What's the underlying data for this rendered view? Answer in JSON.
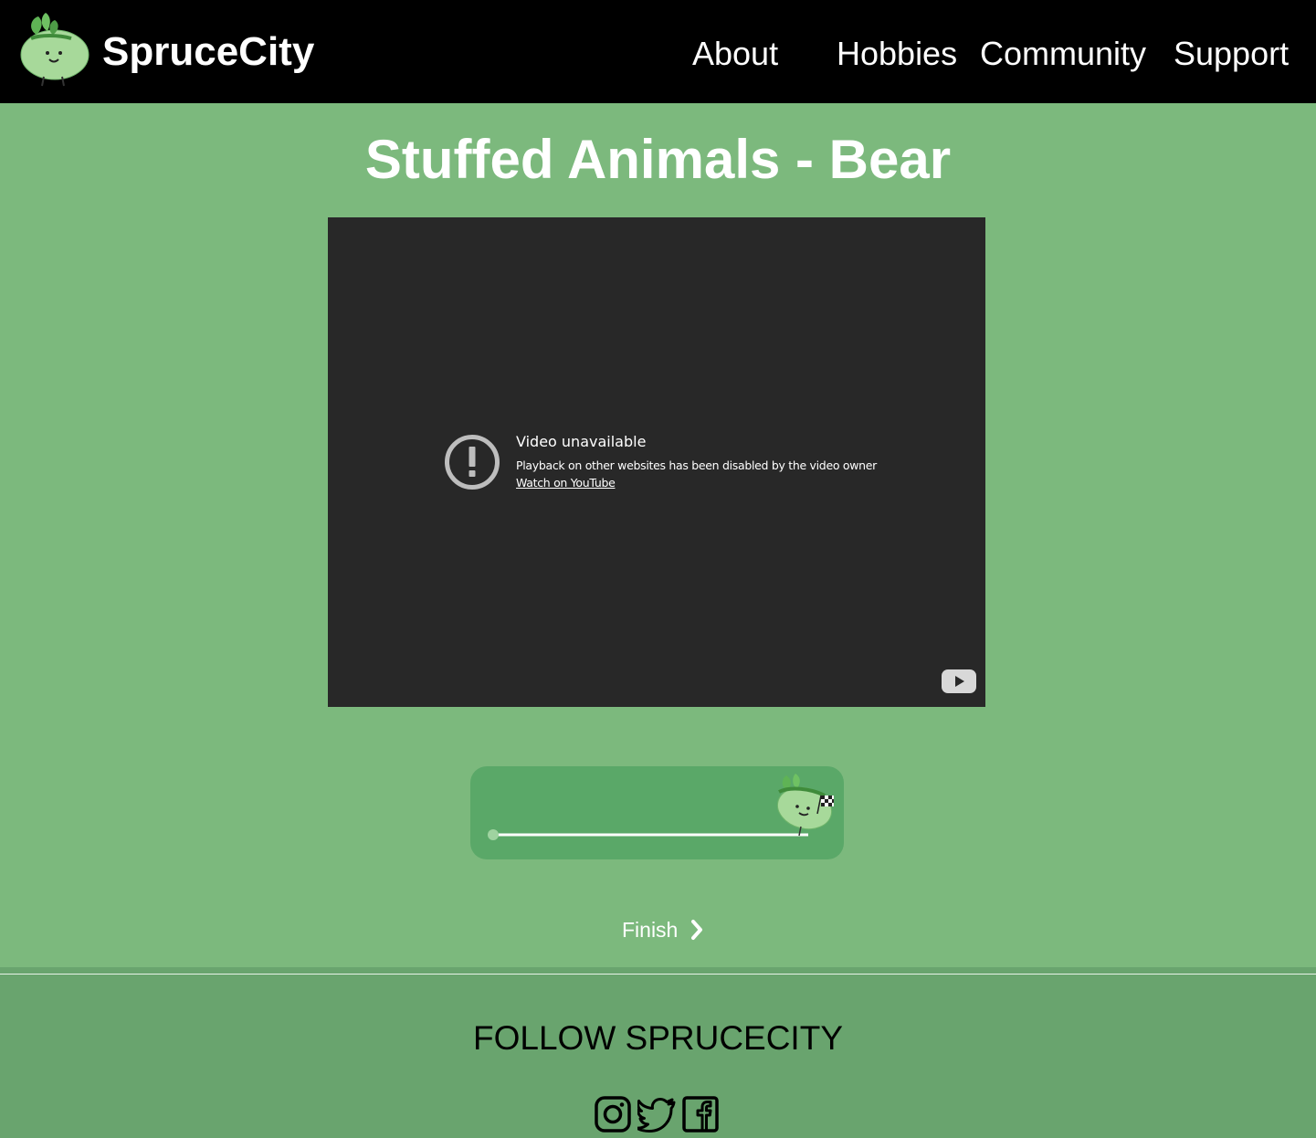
{
  "header": {
    "brand": "SpruceCity",
    "nav": [
      {
        "label": "About"
      },
      {
        "label": "Hobbies"
      },
      {
        "label": "Community"
      },
      {
        "label": "Support"
      }
    ]
  },
  "page": {
    "title": "Stuffed Animals - Bear"
  },
  "video": {
    "error_title": "Video unavailable",
    "error_message": "Playback on other websites has been disabled by the video owner",
    "watch_link": "Watch on YouTube",
    "icons": [
      "exclamation-circle-icon",
      "youtube-logo-icon"
    ]
  },
  "progress": {
    "value": 1.0
  },
  "finish": {
    "label": "Finish"
  },
  "footer": {
    "follow_label": "FOLLOW SPRUCECITY",
    "social_icons": [
      "instagram-icon",
      "twitter-icon",
      "facebook-icon"
    ]
  }
}
